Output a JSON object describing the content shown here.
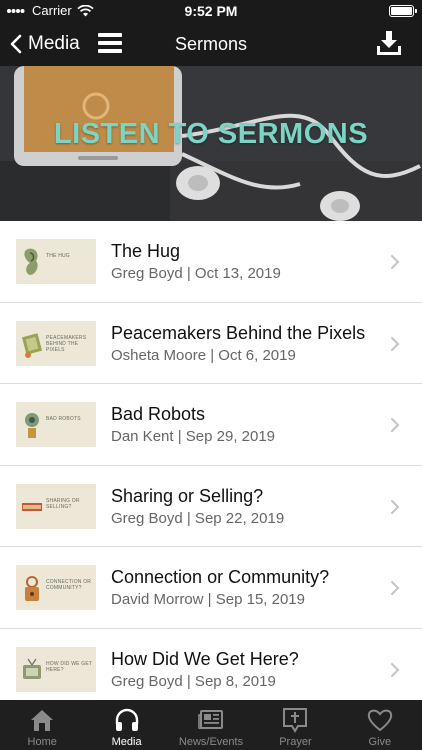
{
  "status_bar": {
    "carrier": "Carrier",
    "time": "9:52 PM"
  },
  "nav": {
    "back_label": "Media",
    "title": "Sermons"
  },
  "hero": {
    "title": "LISTEN TO SERMONS"
  },
  "sermons": [
    {
      "title": "The Hug",
      "meta": "Greg Boyd | Oct 13, 2019",
      "thumb_text": "THE HUG"
    },
    {
      "title": "Peacemakers Behind the Pixels",
      "meta": "Osheta Moore | Oct 6, 2019",
      "thumb_text": "PEACEMAKERS BEHIND THE PIXELS"
    },
    {
      "title": "Bad Robots",
      "meta": "Dan Kent | Sep 29, 2019",
      "thumb_text": "BAD ROBOTS"
    },
    {
      "title": "Sharing or Selling?",
      "meta": "Greg Boyd | Sep 22, 2019",
      "thumb_text": "SHARING OR SELLING?"
    },
    {
      "title": "Connection or Community?",
      "meta": "David Morrow | Sep 15, 2019",
      "thumb_text": "CONNECTION OR COMMUNITY?"
    },
    {
      "title": "How Did We Get Here?",
      "meta": "Greg Boyd | Sep 8, 2019",
      "thumb_text": "HOW DID WE GET HERE?"
    }
  ],
  "tabs": [
    {
      "label": "Home",
      "icon": "home-icon",
      "active": false
    },
    {
      "label": "Media",
      "icon": "headphones-icon",
      "active": true
    },
    {
      "label": "News/Events",
      "icon": "newspaper-icon",
      "active": false
    },
    {
      "label": "Prayer",
      "icon": "prayer-icon",
      "active": false
    },
    {
      "label": "Give",
      "icon": "heart-icon",
      "active": false
    }
  ],
  "colors": {
    "accent": "#7dd3c4",
    "bar": "#1a1a1a",
    "tab_bar": "#1f1f1f",
    "thumb_bg": "#ece7d6"
  }
}
